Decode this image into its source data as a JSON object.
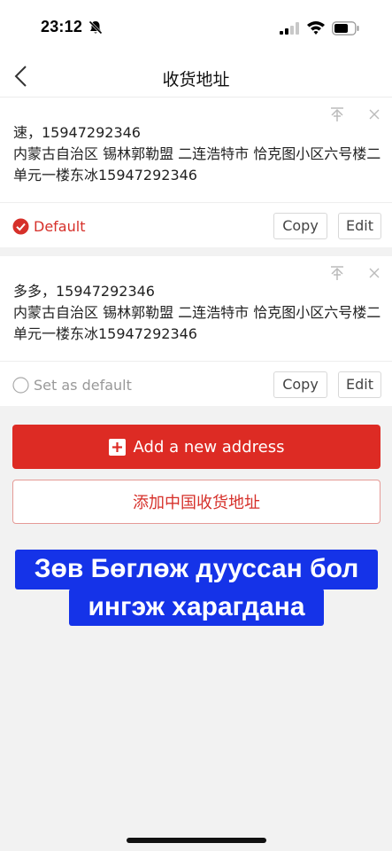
{
  "status_bar": {
    "time": "23:12"
  },
  "nav": {
    "title": "收货地址"
  },
  "addresses": [
    {
      "name_phone": "速，15947292346",
      "detail": "内蒙古自治区 锡林郭勒盟 二连浩特市 恰克图小区六号楼二单元一楼东冰15947292346",
      "default_label": "Default",
      "is_default": true,
      "copy_label": "Copy",
      "edit_label": "Edit"
    },
    {
      "name_phone": "多多，15947292346",
      "detail": "内蒙古自治区 锡林郭勒盟 二连浩特市 恰克图小区六号楼二单元一楼东冰15947292346",
      "default_label": "Set as default",
      "is_default": false,
      "copy_label": "Copy",
      "edit_label": "Edit"
    }
  ],
  "add_button": {
    "label": "Add a new address"
  },
  "add_cn_button": {
    "label": "添加中国收货地址"
  },
  "overlay": {
    "line1": "Зөв Бөглөж дууссан бол",
    "line2": "ингэж харагдана"
  },
  "colors": {
    "accent": "#dd2b24",
    "overlay_bg": "#1533e8"
  }
}
